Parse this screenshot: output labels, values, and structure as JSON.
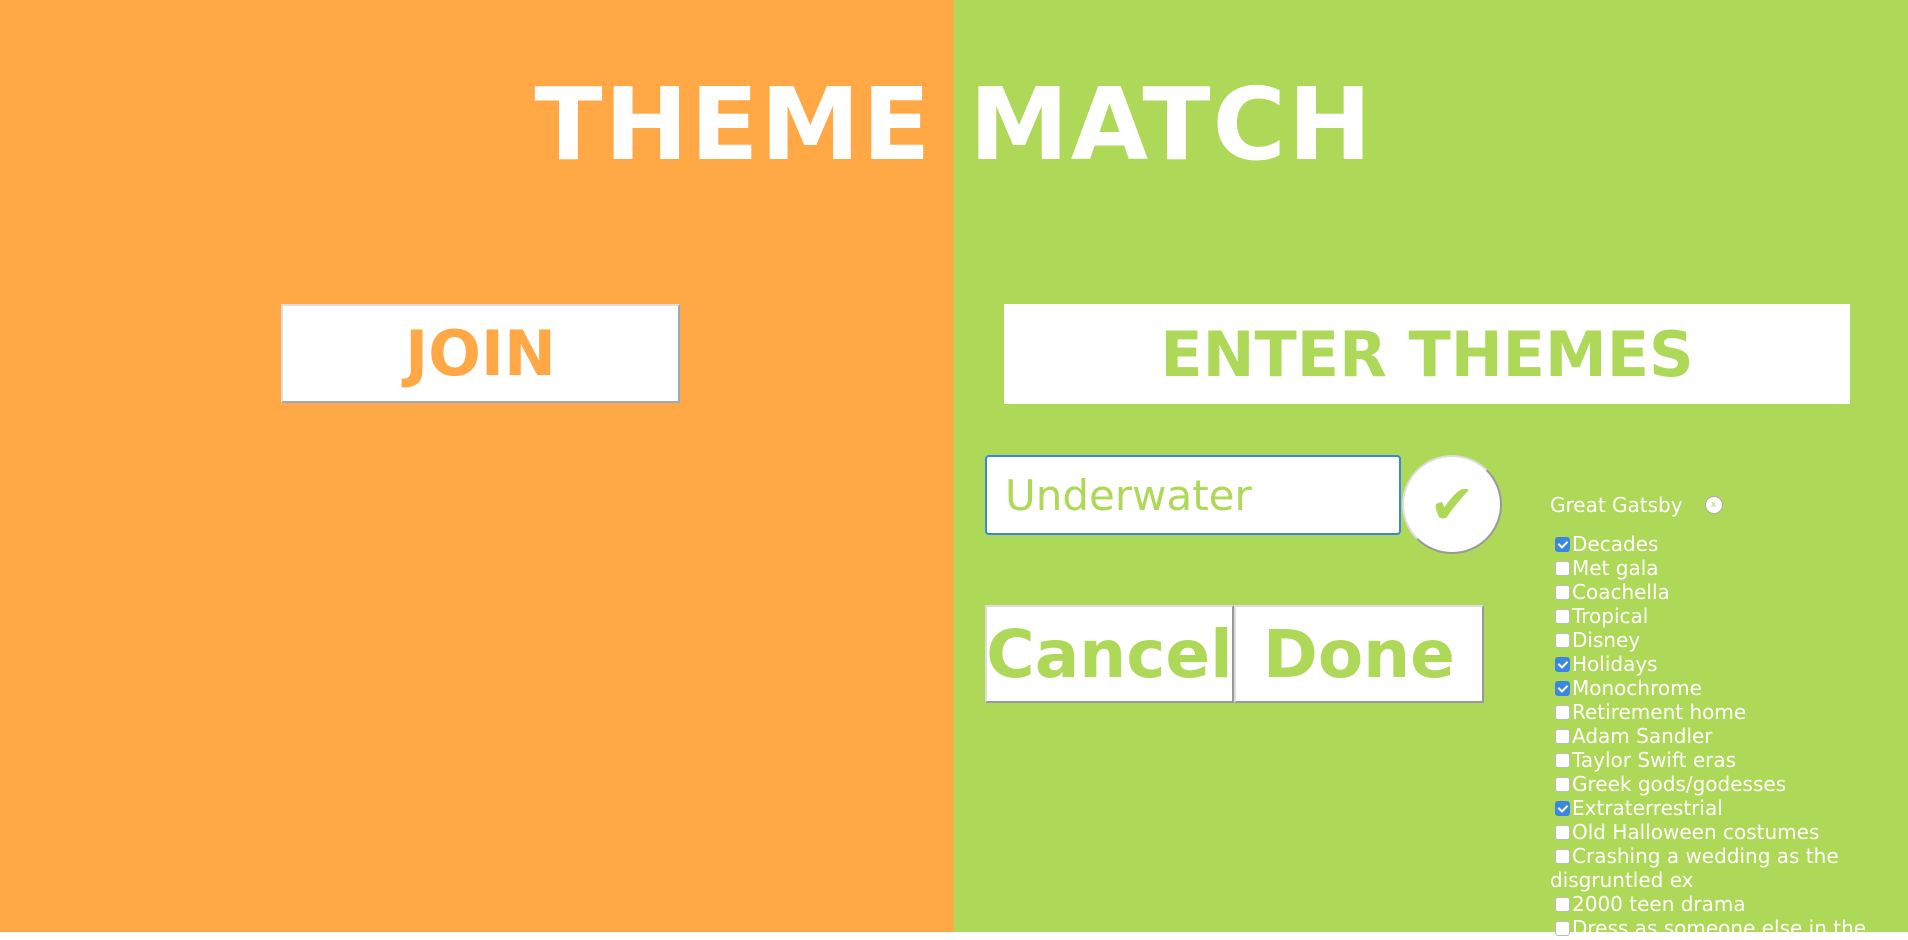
{
  "title": "THEME MATCH",
  "join_label": "JOIN",
  "enter_themes_label": "ENTER THEMES",
  "theme_input": {
    "value": "",
    "placeholder": "Underwater"
  },
  "confirm_icon": "✔",
  "cancel_label": "Cancel",
  "done_label": "Done",
  "entered_theme": {
    "label": "Great Gatsby",
    "remove_icon": "x"
  },
  "themes": [
    {
      "label": "Decades",
      "checked": true
    },
    {
      "label": "Met gala",
      "checked": false
    },
    {
      "label": "Coachella",
      "checked": false
    },
    {
      "label": "Tropical",
      "checked": false
    },
    {
      "label": "Disney",
      "checked": false
    },
    {
      "label": "Holidays",
      "checked": true
    },
    {
      "label": "Monochrome",
      "checked": true
    },
    {
      "label": "Retirement home",
      "checked": false
    },
    {
      "label": "Adam Sandler",
      "checked": false
    },
    {
      "label": "Taylor Swift eras",
      "checked": false
    },
    {
      "label": "Greek gods/godesses",
      "checked": false
    },
    {
      "label": "Extraterrestrial",
      "checked": true
    },
    {
      "label": "Old Halloween costumes",
      "checked": false
    },
    {
      "label": "Crashing a wedding as the disgruntled ex",
      "checked": false
    },
    {
      "label": "2000 teen drama",
      "checked": false
    },
    {
      "label": "Dress as someone else in the",
      "checked": false
    }
  ],
  "colors": {
    "orange": "#FFA845",
    "green": "#AED857",
    "accent": "#3B86E0"
  }
}
